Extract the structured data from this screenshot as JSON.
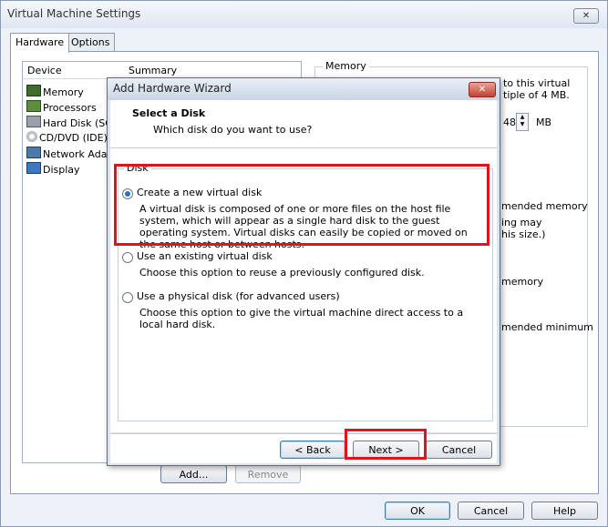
{
  "window": {
    "title": "Virtual Machine Settings",
    "close_glyph": "✕"
  },
  "tabs": [
    {
      "label": "Hardware",
      "active": true
    },
    {
      "label": "Options",
      "active": false
    }
  ],
  "device_list": {
    "col_device": "Device",
    "col_summary": "Summary",
    "items": [
      {
        "label": "Memory",
        "icon": "memory-icon"
      },
      {
        "label": "Processors",
        "icon": "processor-icon"
      },
      {
        "label": "Hard Disk (SCS",
        "icon": "hard-disk-icon"
      },
      {
        "label": "CD/DVD (IDE)",
        "icon": "cd-dvd-icon"
      },
      {
        "label": "Network Adapt",
        "icon": "network-icon"
      },
      {
        "label": "Display",
        "icon": "display-icon"
      }
    ],
    "add_label": "Add...",
    "remove_label": "Remove"
  },
  "memory_panel": {
    "title": "Memory",
    "line1": "to this virtual",
    "line2": "tiple of 4 MB.",
    "value_frag": "48",
    "unit": "MB",
    "rec1": "mended memory",
    "rec2": "ing may",
    "rec3": "his size.)",
    "rec4": "memory",
    "rec5": "mended minimum"
  },
  "footer": {
    "ok": "OK",
    "cancel": "Cancel",
    "help": "Help"
  },
  "wizard": {
    "title": "Add Hardware Wizard",
    "close_glyph": "✕",
    "heading": "Select a Disk",
    "subheading": "Which disk do you want to use?",
    "group_label": "Disk",
    "options": [
      {
        "label": "Create a new virtual disk",
        "selected": true,
        "description": "A virtual disk is composed of one or more files on the host file system, which will appear as a single hard disk to the guest operating system. Virtual disks can easily be copied or moved on the same host or between hosts."
      },
      {
        "label": "Use an existing virtual disk",
        "selected": false,
        "description": "Choose this option to reuse a previously configured disk."
      },
      {
        "label": "Use a physical disk (for advanced users)",
        "selected": false,
        "description": "Choose this option to give the virtual machine direct access to a local hard disk."
      }
    ],
    "back_label": "< Back",
    "next_label": "Next >",
    "cancel_label": "Cancel"
  },
  "colors": {
    "highlight": "#e0141c",
    "accent": "#2a6ec7"
  }
}
